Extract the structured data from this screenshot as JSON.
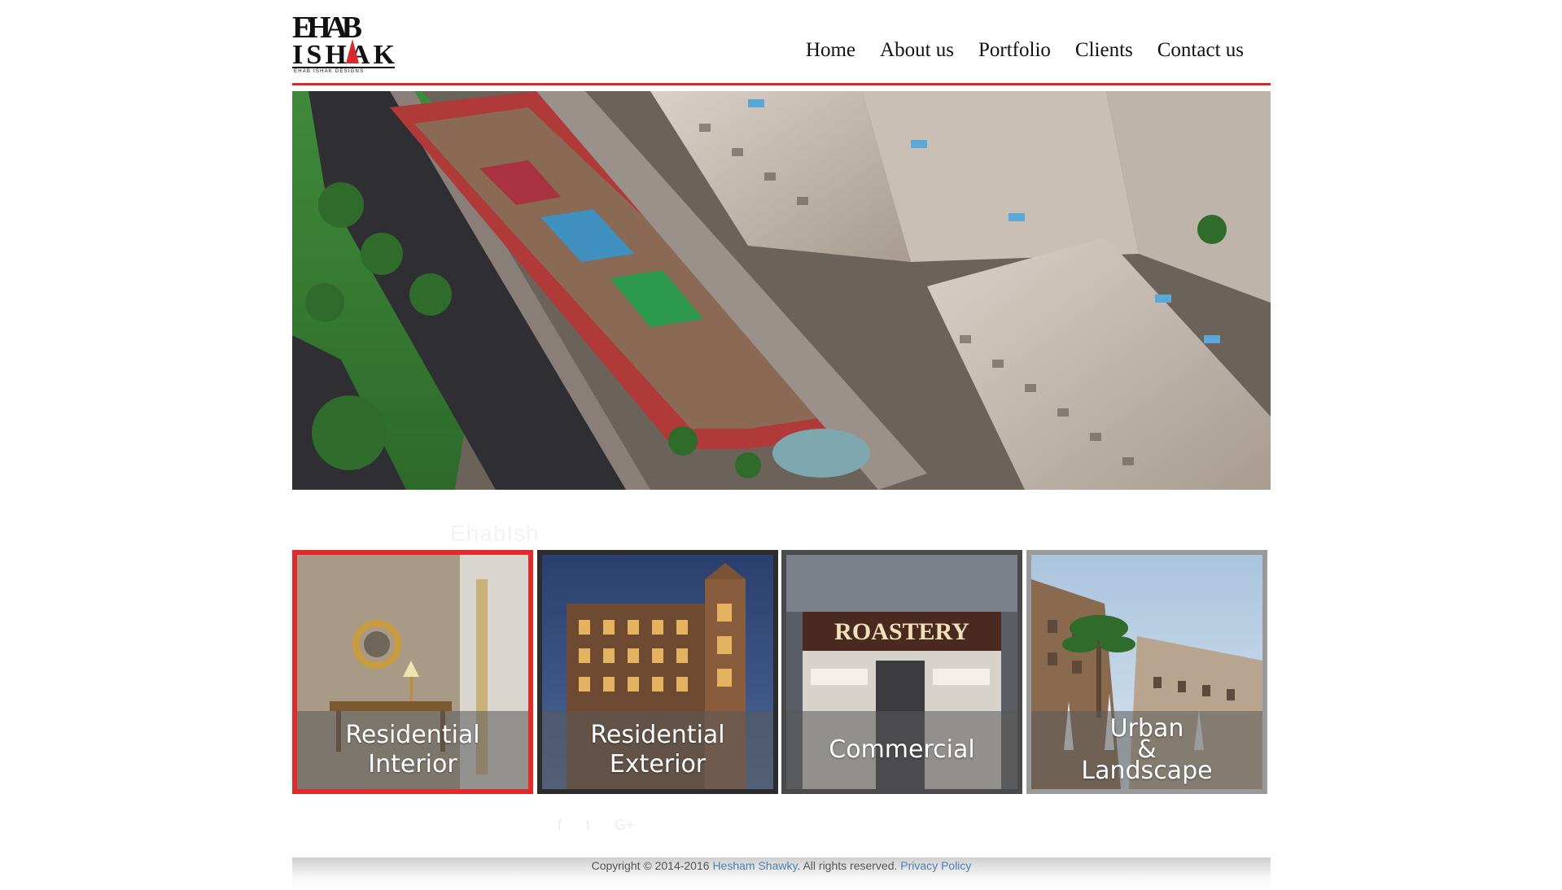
{
  "logo": {
    "text_top": "EHAB",
    "text_bottom": "ISHAK",
    "tagline": "EHAB ISHAK DESIGNS"
  },
  "nav": {
    "home": "Home",
    "about": "About us",
    "portfolio": "Portfolio",
    "clients": "Clients",
    "contact": "Contact us"
  },
  "colors": {
    "accent": "#d72b2b",
    "link": "#4d7fb3"
  },
  "ghost_title": "EhabIsh",
  "tiles": [
    {
      "line1": "Residential",
      "line2": "Interior"
    },
    {
      "line1": "Residential",
      "line2": "Exterior"
    },
    {
      "line1": "Commercial",
      "line2": ""
    },
    {
      "line1": "Urban",
      "line_mid": "&",
      "line2": "Landscape"
    }
  ],
  "storefront_sign": "ROASTERY",
  "social": {
    "facebook": "f",
    "twitter": "t",
    "googleplus": "G+"
  },
  "footer": {
    "prefix": "Copyright © 2014-2016 ",
    "author": "Hesham Shawky",
    "middle": ". All rights reserved. ",
    "privacy": "Privacy Policy"
  }
}
